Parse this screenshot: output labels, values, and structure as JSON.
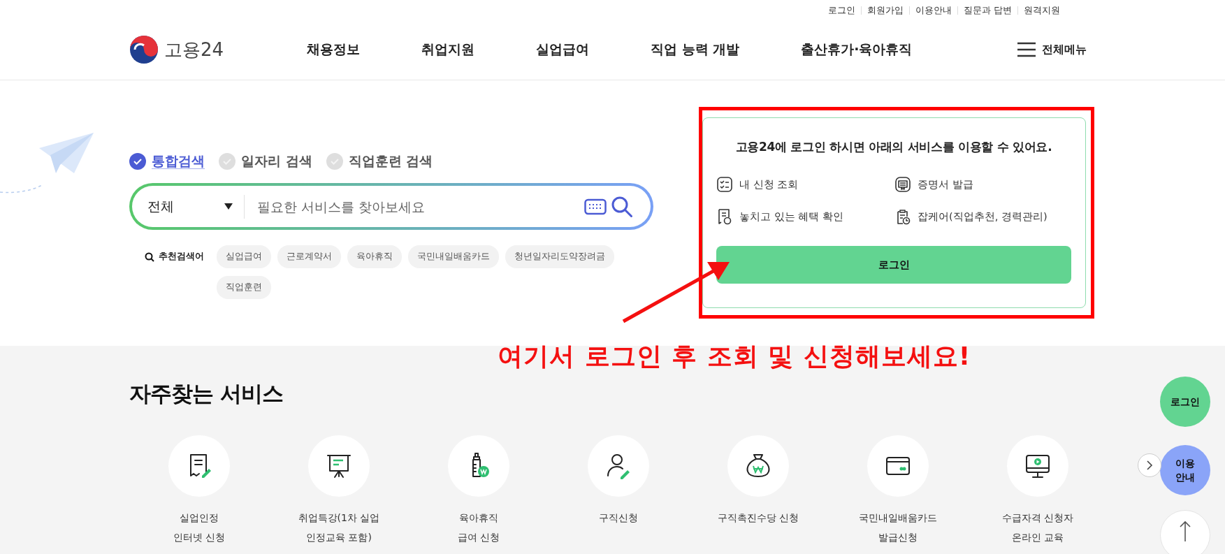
{
  "top_links": [
    "로그인",
    "회원가입",
    "이용안내",
    "질문과 답변",
    "원격지원"
  ],
  "logo": "고용24",
  "nav": [
    "채용정보",
    "취업지원",
    "실업급여",
    "직업 능력 개발",
    "출산휴가·육아휴직"
  ],
  "menu_button": "전체메뉴",
  "search": {
    "tabs": [
      {
        "label": "통합검색",
        "selected": true
      },
      {
        "label": "일자리 검색",
        "selected": false
      },
      {
        "label": "직업훈련 검색",
        "selected": false
      }
    ],
    "category": "전체",
    "placeholder": "필요한 서비스를 찾아보세요",
    "recommend_label": "추천검색어",
    "keywords": [
      "실업급여",
      "근로계약서",
      "육아휴직",
      "국민내일배움카드",
      "청년일자리도약장려금",
      "직업훈련"
    ]
  },
  "login_card": {
    "title": "고용24에 **로그인** 하시면 아래의 서비스를 이용할 수 있어요.",
    "services": [
      "내 신청 조회",
      "증명서 발급",
      "놓치고 있는 혜택 확인",
      "잡케어(직업추천, 경력관리)"
    ],
    "button": "로그인"
  },
  "annotation": "여기서 로그인 후 조회 및 신청해보세요!",
  "frequent": {
    "title": "자주찾는 서비스",
    "items": [
      {
        "label": "실업인정\n인터넷 신청"
      },
      {
        "label": "취업특강(1차 실업\n인정교육 포함)"
      },
      {
        "label": "육아휴직\n급여 신청"
      },
      {
        "label": "구직신청"
      },
      {
        "label": "구직촉진수당 신청"
      },
      {
        "label": "국민내일배움카드\n발급신청"
      },
      {
        "label": "수급자격 신청자\n온라인 교육"
      }
    ]
  },
  "floating": [
    {
      "label": "로그인",
      "kind": "login"
    },
    {
      "label": "이용\n안내",
      "kind": "guide"
    }
  ]
}
